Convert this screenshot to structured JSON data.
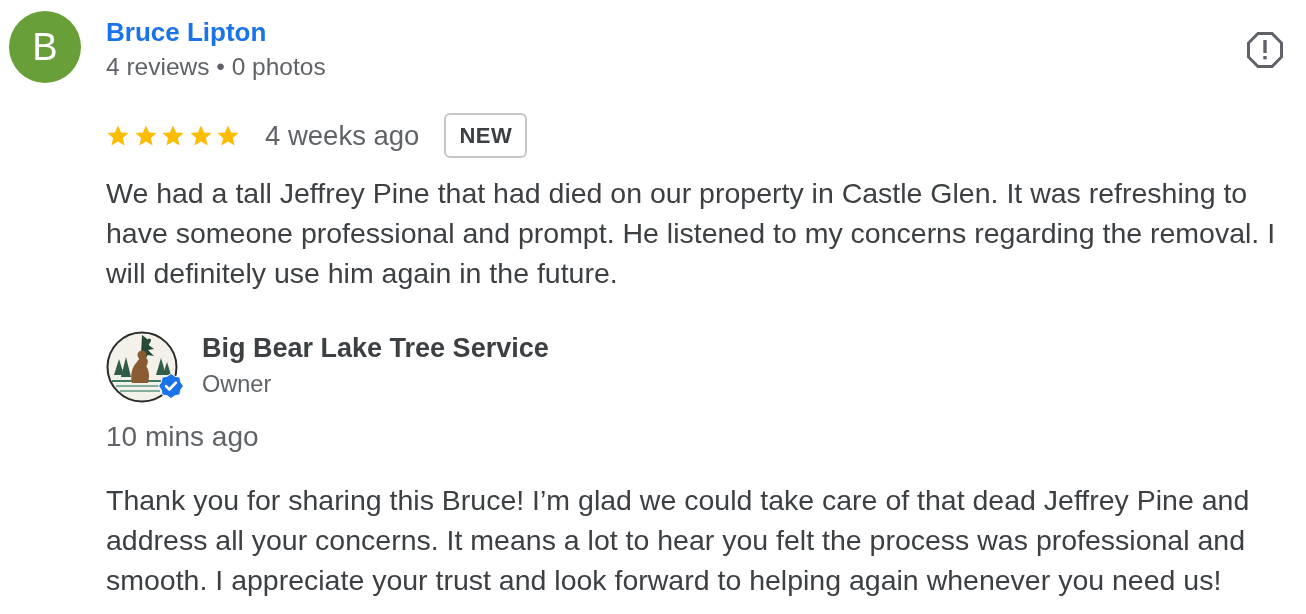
{
  "reviewer": {
    "initial": "B",
    "name": "Bruce Lipton",
    "stats": "4 reviews • 0 photos"
  },
  "review": {
    "stars": 5,
    "time": "4 weeks ago",
    "badge": "NEW",
    "text": "We had a tall Jeffrey Pine that had died on our property in Castle Glen. It was refreshing to have someone professional and prompt. He listened to my concerns regarding the removal. I will definitely use him again in the future."
  },
  "owner_response": {
    "name": "Big Bear Lake Tree Service",
    "role": "Owner",
    "verified": true,
    "time": "10 mins ago",
    "text": "Thank you for sharing this Bruce! I’m glad we could take care of that dead Jeffrey Pine and address all your concerns. It means a lot to hear you felt the process was professional and smooth. I appreciate your trust and look forward to helping again whenever you need us!"
  }
}
